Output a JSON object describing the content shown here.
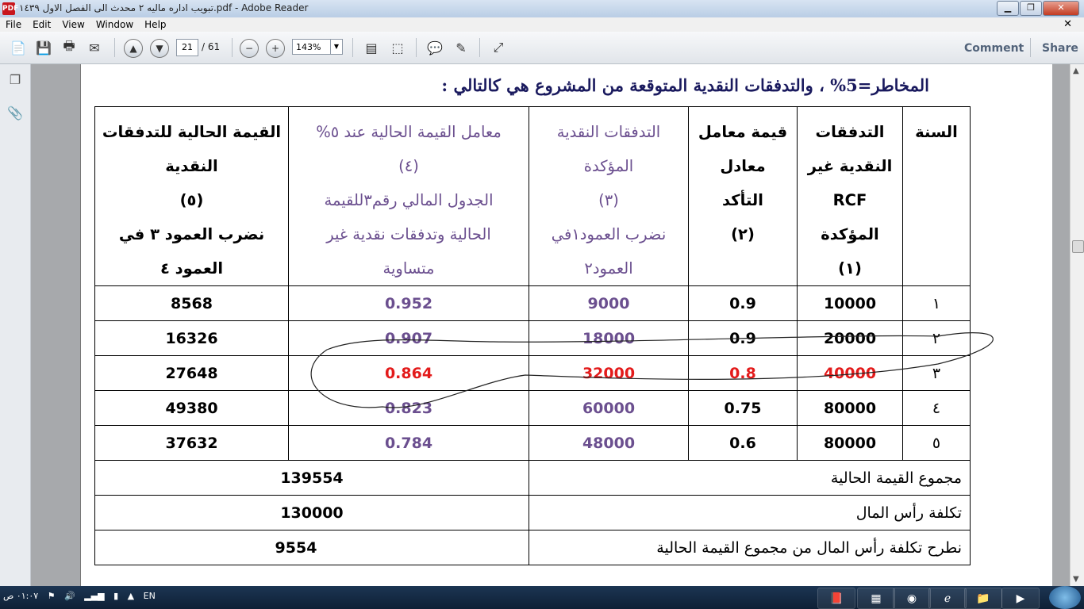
{
  "window": {
    "title": "تبويب اداره ماليه ٢ محدث الى الفصل الاول ١٤٣٩.pdf - Adobe Reader",
    "buttons": {
      "minimize": "▁",
      "restore": "❐",
      "close": "✕"
    }
  },
  "menu": {
    "items": [
      "File",
      "Edit",
      "View",
      "Window",
      "Help"
    ],
    "close": "✕"
  },
  "toolbar": {
    "page_current": "21",
    "page_total": "/ 61",
    "zoom": "143%",
    "comment_label": "Comment",
    "share_label": "Share"
  },
  "document": {
    "heading": "المخاطر=5% ، والتدفقات النقدية المتوقعة من المشروع هي كالتالي :",
    "headers": {
      "year": [
        "السنة"
      ],
      "rcf": [
        "التدفقات",
        "النقدية غير",
        "RCF",
        "المؤكدة",
        "(١)"
      ],
      "factor": [
        "قيمة معامل",
        "معادل",
        "التأكد",
        "(٢)"
      ],
      "certain": [
        "التدفقات النقدية",
        "المؤكدة",
        "(٣)",
        "نضرب العمود١في",
        "العمود٢"
      ],
      "pv_factor": [
        "معامل القيمة الحالية عند ٥%",
        "(٤)",
        "الجدول المالي رقم٣للقيمة",
        "الحالية وتدفقات نقدية غير",
        "متساوية"
      ],
      "pv": [
        "القيمة الحالية للتدفقات",
        "النقدية",
        "(٥)",
        "نضرب العمود ٣ في",
        "العمود ٤"
      ]
    },
    "rows": [
      {
        "year": "١",
        "rcf": "10000",
        "factor": "0.9",
        "certain": "9000",
        "pv_factor": "0.952",
        "pv": "8568",
        "highlight": false
      },
      {
        "year": "٢",
        "rcf": "20000",
        "factor": "0.9",
        "certain": "18000",
        "pv_factor": "0.907",
        "pv": "16326",
        "highlight": false
      },
      {
        "year": "٣",
        "rcf": "40000",
        "factor": "0.8",
        "certain": "32000",
        "pv_factor": "0.864",
        "pv": "27648",
        "highlight": true
      },
      {
        "year": "٤",
        "rcf": "80000",
        "factor": "0.75",
        "certain": "60000",
        "pv_factor": "0.823",
        "pv": "49380",
        "highlight": false
      },
      {
        "year": "٥",
        "rcf": "80000",
        "factor": "0.6",
        "certain": "48000",
        "pv_factor": "0.784",
        "pv": "37632",
        "highlight": false
      }
    ],
    "summary": [
      {
        "label": "مجموع القيمة الحالية",
        "value": "139554"
      },
      {
        "label": "تكلفة رأس المال",
        "value": "130000"
      },
      {
        "label": "نطرح تكلفة رأس المال من مجموع القيمة الحالية",
        "value": "9554"
      }
    ]
  },
  "taskbar": {
    "clock": "٠١:٠٧ ص",
    "language": "EN"
  },
  "colors": {
    "highlight_red": "#e31b1b",
    "purple_text": "#6b4f8f",
    "heading_navy": "#1a1a5e"
  }
}
